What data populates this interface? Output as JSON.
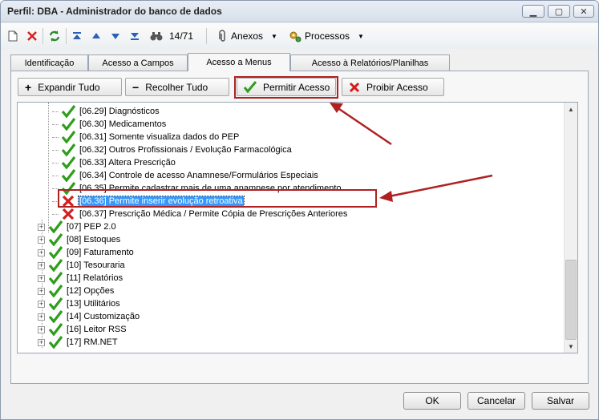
{
  "window": {
    "title": "Perfil: DBA - Administrador do banco de dados"
  },
  "toolbar": {
    "counter": "14/71",
    "anexos_label": "Anexos",
    "processos_label": "Processos"
  },
  "tabs": [
    {
      "label": "Identificação",
      "active": false
    },
    {
      "label": "Acesso a Campos",
      "active": false
    },
    {
      "label": "Acesso a Menus",
      "active": true
    },
    {
      "label": "Acesso à Relatórios/Planilhas",
      "active": false
    }
  ],
  "actions": {
    "expand_label": "Expandir Tudo",
    "collapse_label": "Recolher Tudo",
    "allow_label": "Permitir Acesso",
    "deny_label": "Proibir Acesso"
  },
  "tree_items": [
    {
      "label": "[06.29] Diagnósticos",
      "allowed": true
    },
    {
      "label": "[06.30] Medicamentos",
      "allowed": true
    },
    {
      "label": "[06.31] Somente visualiza dados do PEP",
      "allowed": true
    },
    {
      "label": "[06.32] Outros Profissionais / Evolução Farmacológica",
      "allowed": true
    },
    {
      "label": "[06.33] Altera Prescrição",
      "allowed": true
    },
    {
      "label": "[06.34] Controle de acesso Anamnese/Formulários Especiais",
      "allowed": true
    },
    {
      "label": "[06.35] Permite cadastrar mais de uma anamnese por atendimento",
      "allowed": true
    },
    {
      "label": "[06.36] Permite inserir evolução retroativa",
      "allowed": false,
      "selected": true
    },
    {
      "label": "[06.37] Prescrição Médica / Permite Cópia de Prescrições Anteriores",
      "allowed": false
    },
    {
      "label": "[07] PEP 2.0",
      "allowed": true,
      "top": true
    },
    {
      "label": "[08] Estoques",
      "allowed": true,
      "top": true
    },
    {
      "label": "[09] Faturamento",
      "allowed": true,
      "top": true
    },
    {
      "label": "[10] Tesouraria",
      "allowed": true,
      "top": true
    },
    {
      "label": "[11] Relatórios",
      "allowed": true,
      "top": true
    },
    {
      "label": "[12] Opções",
      "allowed": true,
      "top": true
    },
    {
      "label": "[13] Utilitários",
      "allowed": true,
      "top": true
    },
    {
      "label": "[14] Customização",
      "allowed": true,
      "top": true
    },
    {
      "label": "[16] Leitor RSS",
      "allowed": true,
      "top": true
    },
    {
      "label": "[17] RM.NET",
      "allowed": true,
      "top": true
    }
  ],
  "dialog": {
    "ok_label": "OK",
    "cancel_label": "Cancelar",
    "save_label": "Salvar"
  },
  "colors": {
    "allow": "#2e9e1a",
    "deny": "#d41e1e",
    "annotation": "#b02020",
    "selection": "#3399ff"
  }
}
